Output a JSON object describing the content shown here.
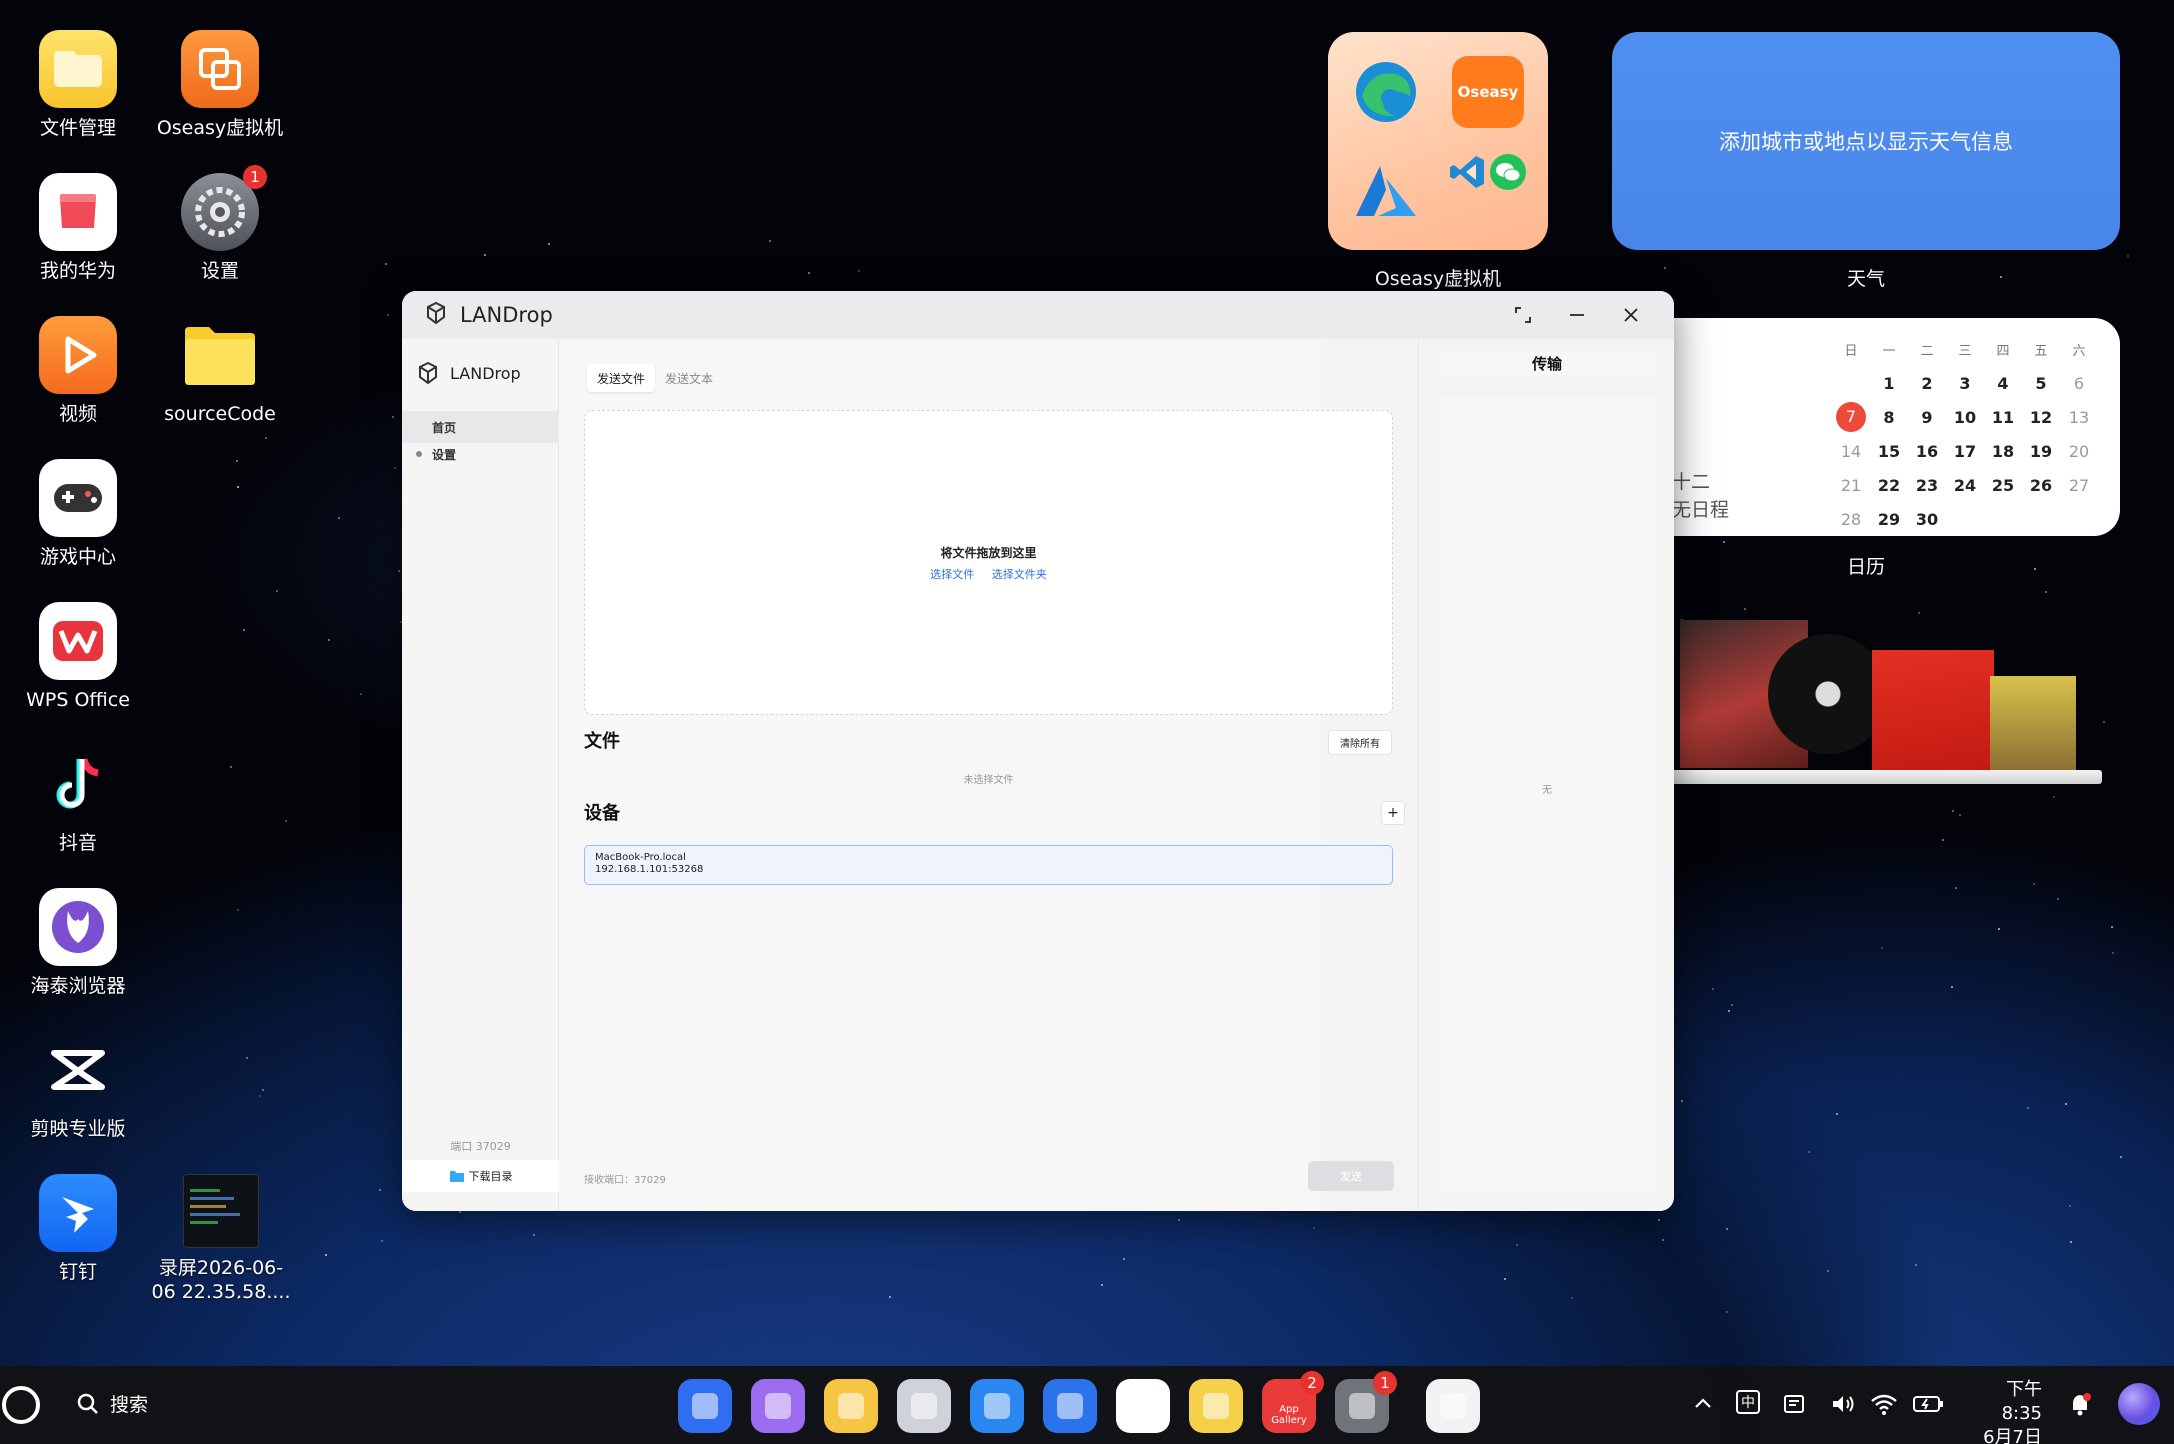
{
  "desktop_icons": [
    {
      "label": "文件管理",
      "icon": "folder-icon"
    },
    {
      "label": "Oseasy虚拟机",
      "icon": "oseasy-vm-icon"
    },
    {
      "label": "我的华为",
      "icon": "my-huawei-icon"
    },
    {
      "label": "设置",
      "icon": "settings-icon",
      "badge": "1"
    },
    {
      "label": "视频",
      "icon": "video-icon"
    },
    {
      "label": "sourceCode",
      "icon": "folder-icon"
    },
    {
      "label": "游戏中心",
      "icon": "game-center-icon"
    },
    {
      "label": "WPS Office",
      "icon": "wps-icon"
    },
    {
      "label": "抖音",
      "icon": "douyin-icon"
    },
    {
      "label": "海泰浏览器",
      "icon": "browser-icon"
    },
    {
      "label": "剪映专业版",
      "icon": "capcut-icon"
    },
    {
      "label": "钉钉",
      "icon": "dingtalk-icon"
    },
    {
      "label": "录屏2026-06-06 22.35.58....",
      "line1": "录屏2026-06-",
      "line2": "06 22.35.58....",
      "icon": "screen-recording-thumbnail"
    }
  ],
  "widgets": {
    "folder_widget": {
      "label": "Oseasy虚拟机",
      "inner_badge": "Oseasy"
    },
    "weather": {
      "message": "添加城市或地点以显示天气信息",
      "label": "天气"
    },
    "calendar": {
      "label": "日历",
      "side_text_1": "十二",
      "side_text_2": "无日程",
      "weekdays": [
        "日",
        "一",
        "二",
        "三",
        "四",
        "五",
        "六"
      ],
      "today": "7",
      "weeks": [
        [
          "",
          "1",
          "2",
          "3",
          "4",
          "5",
          "6"
        ],
        [
          "7",
          "8",
          "9",
          "10",
          "11",
          "12",
          "13"
        ],
        [
          "14",
          "15",
          "16",
          "17",
          "18",
          "19",
          "20"
        ],
        [
          "21",
          "22",
          "23",
          "24",
          "25",
          "26",
          "27"
        ],
        [
          "28",
          "29",
          "30",
          "",
          "",
          "",
          ""
        ]
      ]
    }
  },
  "window": {
    "title": "LANDrop",
    "sidebar": {
      "app_name": "LANDrop",
      "nav": [
        "首页",
        "设置"
      ],
      "port": "端口 37029",
      "download_dir": "下载目录"
    },
    "main": {
      "tabs": [
        "发送文件",
        "发送文本"
      ],
      "active_tab": "发送文件",
      "dropzone_title": "将文件拖放到这里",
      "select_file": "选择文件",
      "select_folder": "选择文件夹",
      "files_title": "文件",
      "clear_all": "清除所有",
      "no_files": "未选择文件",
      "devices_title": "设备",
      "add_symbol": "+",
      "device": {
        "name": "MacBook-Pro.local",
        "address": "192.168.1.101:53268"
      },
      "receive_port": "接收端口：37029",
      "send": "发送"
    },
    "transfer": {
      "title": "传输",
      "empty": "无"
    }
  },
  "taskbar": {
    "search": "搜索",
    "apps": [
      {
        "icon": "app-drawer-icon",
        "color": "#2f6ef0"
      },
      {
        "icon": "multitask-icon",
        "color": "#9b6cf0"
      },
      {
        "icon": "files-icon",
        "color": "#f6c542"
      },
      {
        "icon": "trash-icon",
        "color": "#cfd3d9"
      },
      {
        "icon": "browser-icon",
        "color": "#2a86f0"
      },
      {
        "icon": "mail-icon",
        "color": "#2b73ea"
      },
      {
        "icon": "gallery-icon",
        "color": "#ffffff"
      },
      {
        "icon": "notes-icon",
        "color": "#f7d04a"
      },
      {
        "icon": "app-gallery-icon",
        "color": "#ea3b3b",
        "badge": "2",
        "text": "App Gallery"
      },
      {
        "icon": "settings-icon",
        "color": "#6f737a",
        "badge": "1"
      },
      {
        "icon": "landrop-icon",
        "color": "#f2f2f2"
      }
    ],
    "ime": "中",
    "time": "下午8:35",
    "date": "6月7日"
  }
}
